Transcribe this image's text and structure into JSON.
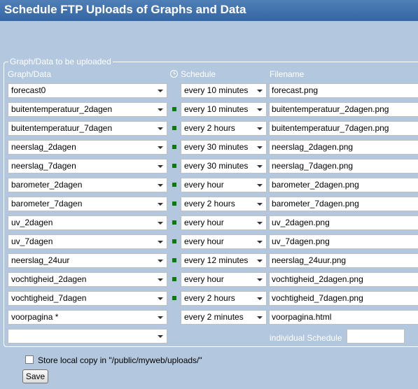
{
  "title": "Schedule FTP Uploads of Graphs and Data",
  "group_legend": "Graph/Data to be uploaded",
  "columns": {
    "graph": "Graph/Data",
    "schedule": "Schedule",
    "filename": "Filename"
  },
  "rows": [
    {
      "graph": "forecast0",
      "schedule": "every 10 minutes",
      "filename": "forecast.png",
      "active": false
    },
    {
      "graph": "buitentemperatuur_2dagen",
      "schedule": "every 10 minutes",
      "filename": "buitentemperatuur_2dagen.png",
      "active": true
    },
    {
      "graph": "buitentemperatuur_7dagen",
      "schedule": "every 2 hours",
      "filename": "buitentemperatuur_7dagen.png",
      "active": true
    },
    {
      "graph": "neerslag_2dagen",
      "schedule": "every 30 minutes",
      "filename": "neerslag_2dagen.png",
      "active": true
    },
    {
      "graph": "neerslag_7dagen",
      "schedule": "every 30 minutes",
      "filename": "neerslag_7dagen.png",
      "active": true
    },
    {
      "graph": "barometer_2dagen",
      "schedule": "every hour",
      "filename": "barometer_2dagen.png",
      "active": true
    },
    {
      "graph": "barometer_7dagen",
      "schedule": "every 2 hours",
      "filename": "barometer_7dagen.png",
      "active": true
    },
    {
      "graph": "uv_2dagen",
      "schedule": "every hour",
      "filename": "uv_2dagen.png",
      "active": true
    },
    {
      "graph": "uv_7dagen",
      "schedule": "every hour",
      "filename": "uv_7dagen.png",
      "active": true
    },
    {
      "graph": "neerslag_24uur",
      "schedule": "every 12 minutes",
      "filename": "neerslag_24uur.png",
      "active": true
    },
    {
      "graph": "vochtigheid_2dagen",
      "schedule": "every hour",
      "filename": "vochtigheid_2dagen.png",
      "active": true
    },
    {
      "graph": "vochtigheid_7dagen",
      "schedule": "every 2 hours",
      "filename": "vochtigheid_7dagen.png",
      "active": true
    },
    {
      "graph": "voorpagina *",
      "schedule": "every 2 minutes",
      "filename": "voorpagina.html",
      "active": false
    }
  ],
  "new_row": {
    "graph": "",
    "individual_schedule_label": "individual Schedule",
    "individual_schedule_value": ""
  },
  "store_local": {
    "label": "Store local copy in \"/public/myweb/uploads/\"",
    "checked": false
  },
  "save_label": "Save",
  "colors": {
    "title_bar": "#3566a4",
    "background": "#b3c8de",
    "active_marker": "#0b7a0b"
  },
  "icons": {
    "schedule_header": "clock-icon",
    "dropdown": "chevron-down-icon",
    "active_marker": "green-square-icon"
  }
}
